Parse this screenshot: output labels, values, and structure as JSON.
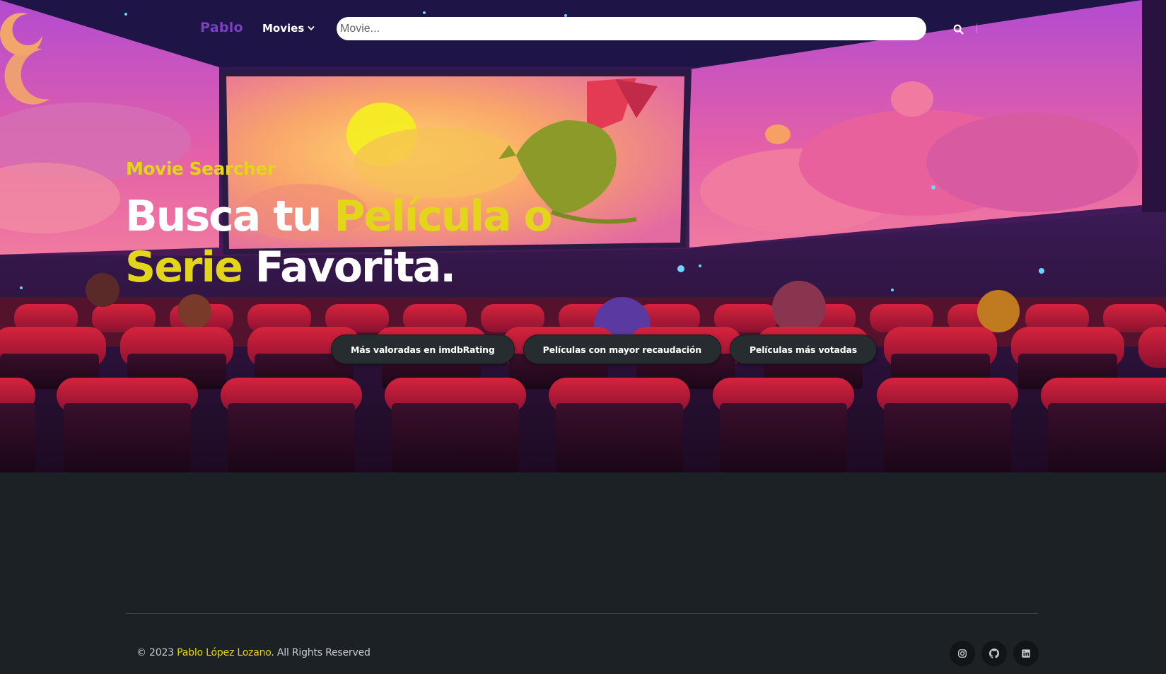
{
  "nav": {
    "brand": "Pablo",
    "movies_label": "Movies",
    "search_placeholder": "Movie..."
  },
  "hero": {
    "eyebrow": "Movie Searcher",
    "headline_part1": "Busca tu ",
    "headline_highlight": "Película o Serie",
    "headline_part2": " Favorita."
  },
  "pills": [
    "Más valoradas en imdbRating",
    "Películas con mayor recaudación",
    "Películas más votadas"
  ],
  "footer": {
    "copyright_prefix": "© 2023 ",
    "owner": "Pablo López Lozano",
    "copyright_suffix": ". All Rights Reserved",
    "social_icons": [
      "instagram-icon",
      "github-icon",
      "linkedin-icon"
    ]
  },
  "colors": {
    "accent_yellow": "#e3d61a",
    "brand_purple": "#7b3fc2",
    "footer_bg": "#1b2124",
    "pill_bg": "#262c30"
  }
}
